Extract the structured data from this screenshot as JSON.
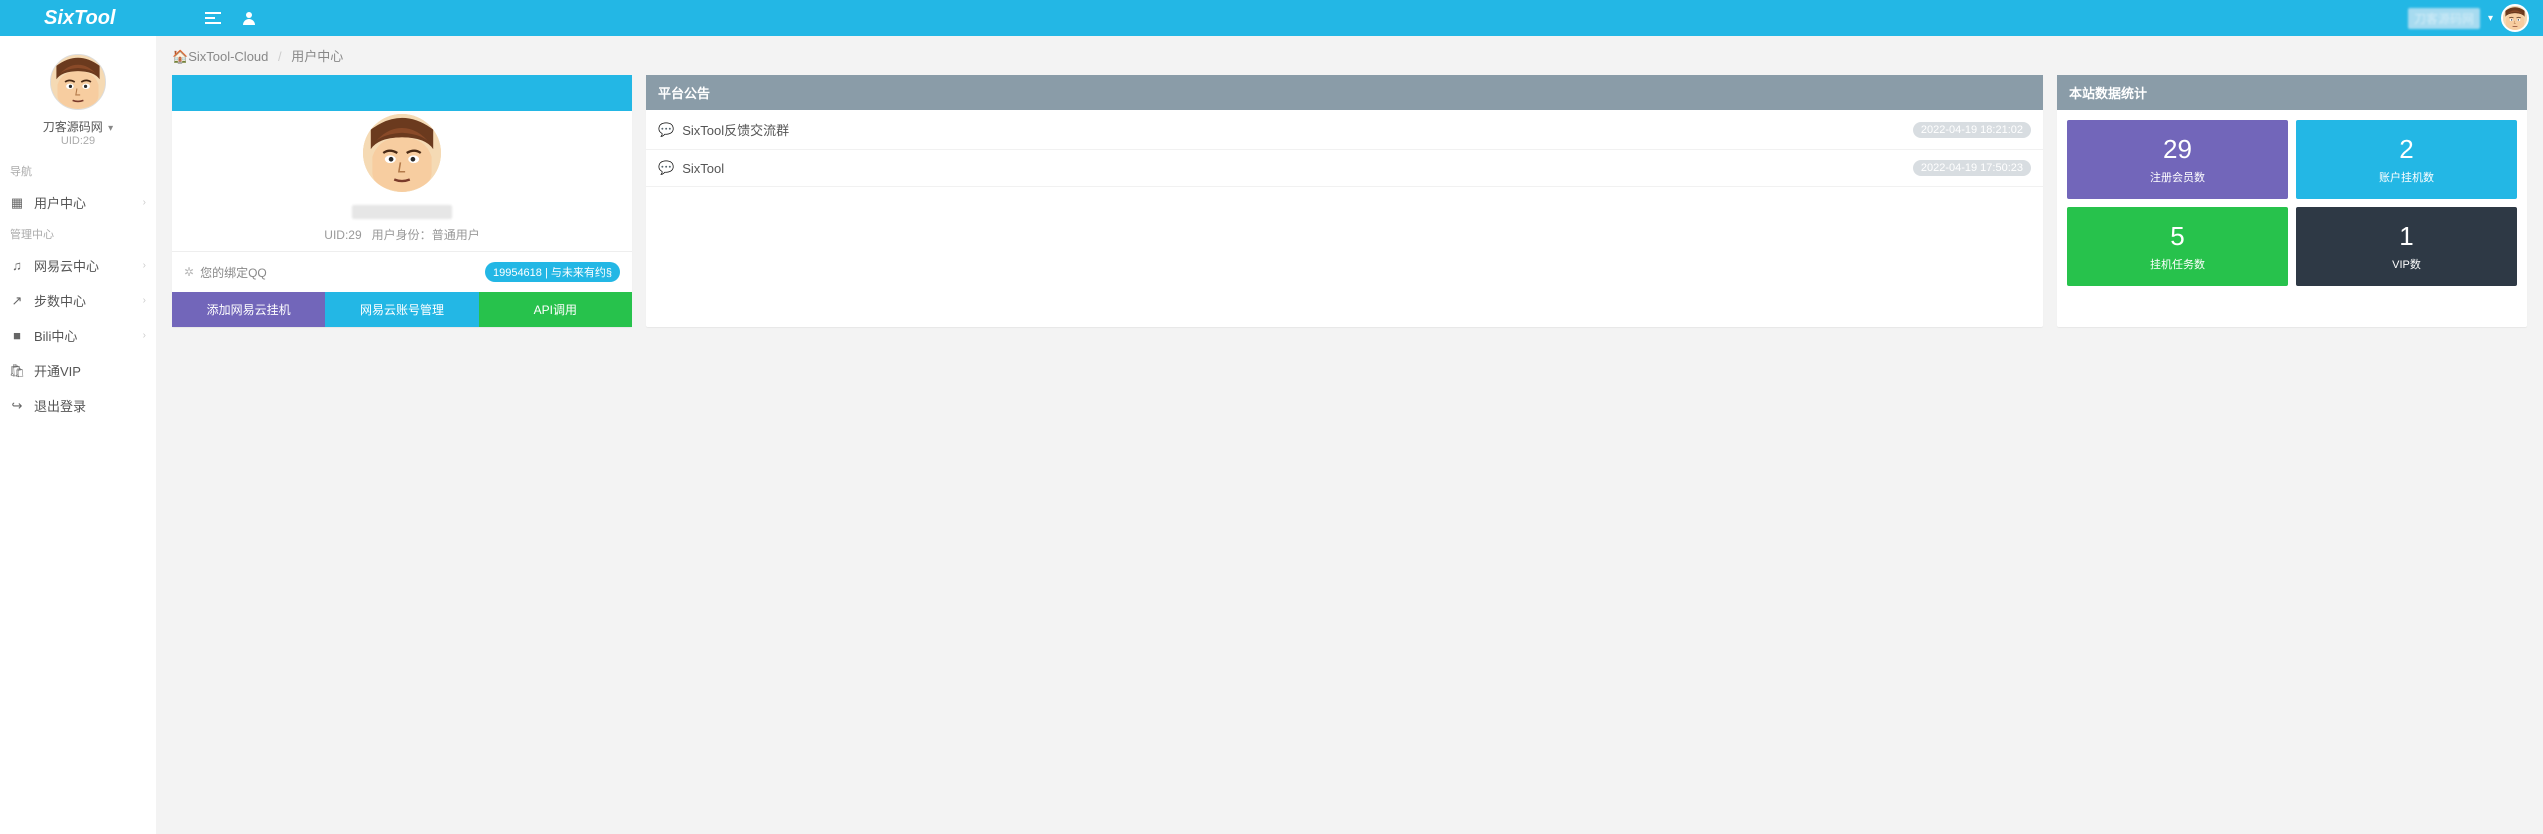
{
  "brand": "SixTool",
  "top_user": "刀客源码网",
  "breadcrumb": {
    "root": "SixTool-Cloud",
    "current": "用户中心"
  },
  "sidebar": {
    "profile_name": "刀客源码网",
    "profile_uid": "UID:29",
    "section1": "导航",
    "section2": "管理中心",
    "items1": [
      {
        "label": "用户中心",
        "expandable": true
      }
    ],
    "items2": [
      {
        "label": "网易云中心",
        "expandable": true
      },
      {
        "label": "步数中心",
        "expandable": true
      },
      {
        "label": "Bili中心",
        "expandable": true
      },
      {
        "label": "开通VIP",
        "expandable": false
      },
      {
        "label": "退出登录",
        "expandable": false
      }
    ]
  },
  "profile_card": {
    "uid_label": "UID:29",
    "role_label": "用户身份：",
    "role_value": "普通用户",
    "bind_qq_label": "您的绑定QQ",
    "bind_qq_badge": "19954618 | 与未来有约§",
    "btn_add": "添加网易云挂机",
    "btn_manage": "网易云账号管理",
    "btn_api": "API调用"
  },
  "announce": {
    "title": "平台公告",
    "items": [
      {
        "text": "SixTool反馈交流群",
        "date": "2022-04-19 18:21:02"
      },
      {
        "text": "SixTool",
        "date": "2022-04-19 17:50:23"
      }
    ]
  },
  "stats": {
    "title": "本站数据统计",
    "tiles": [
      {
        "num": "29",
        "label": "注册会员数"
      },
      {
        "num": "2",
        "label": "账户挂机数"
      },
      {
        "num": "5",
        "label": "挂机任务数"
      },
      {
        "num": "1",
        "label": "VIP数"
      }
    ]
  }
}
